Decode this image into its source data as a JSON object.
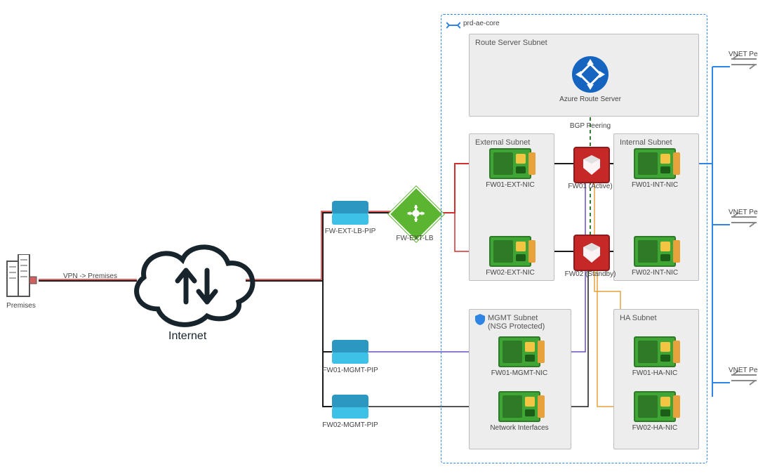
{
  "onprem": {
    "label": "Premises"
  },
  "vpn_label": "VPN -> Premises",
  "internet": {
    "label": "Internet"
  },
  "pips": {
    "ext_lb": "FW-EXT-LB-PIP",
    "mgmt1": "FW01-MGMT-PIP",
    "mgmt2": "FW02-MGMT-PIP"
  },
  "lb": {
    "label": "FW-EXT-LB"
  },
  "vnet": {
    "name": "prd-ae-core",
    "route_subnet": {
      "title": "Route Server Subnet",
      "server": "Azure Route Server"
    },
    "bgp_label": "BGP Peering",
    "external": {
      "title": "External Subnet",
      "nic1": "FW01-EXT-NIC",
      "nic2": "FW02-EXT-NIC"
    },
    "internal": {
      "title": "Internal Subnet",
      "nic1": "FW01-INT-NIC",
      "nic2": "FW02-INT-NIC"
    },
    "firewalls": {
      "fw1": "FW01 (Active)",
      "fw2": "FW02 (Standby)"
    },
    "mgmt": {
      "title": "MGMT Subnet\n(NSG Protected)",
      "nic1": "FW01-MGMT-NIC",
      "nic2": "Network Interfaces"
    },
    "ha": {
      "title": "HA Subnet",
      "nic1": "FW01-HA-NIC",
      "nic2": "FW02-HA-NIC"
    }
  },
  "peers": {
    "p1": "VNET Peer",
    "p2": "VNET Peer",
    "p3": "VNET Peer"
  }
}
